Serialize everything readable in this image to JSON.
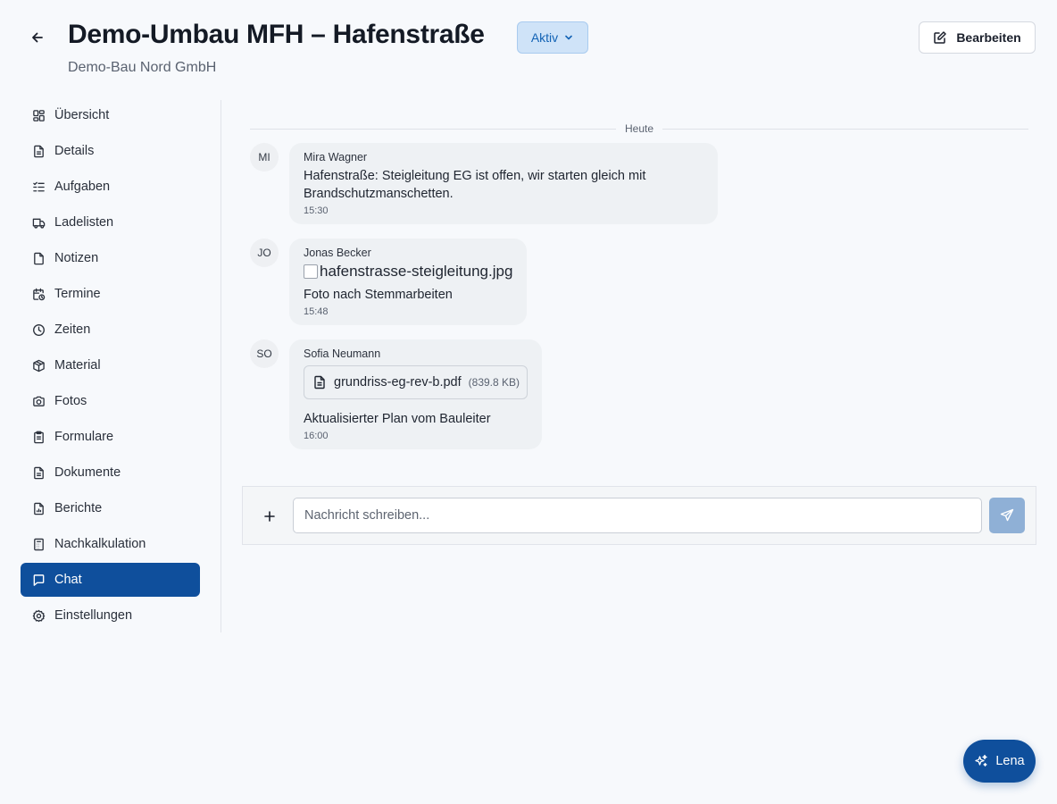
{
  "header": {
    "title": "Demo-Umbau MFH – Hafenstraße",
    "status_label": "Aktiv",
    "subtitle": "Demo-Bau Nord GmbH",
    "edit_label": "Bearbeiten",
    "back_icon": "arrow-left-icon"
  },
  "sidebar": {
    "items": [
      {
        "label": "Übersicht",
        "icon": "layout-grid-icon",
        "active": false
      },
      {
        "label": "Details",
        "icon": "file-text-icon",
        "active": false
      },
      {
        "label": "Aufgaben",
        "icon": "checklist-icon",
        "active": false
      },
      {
        "label": "Ladelisten",
        "icon": "truck-icon",
        "active": false
      },
      {
        "label": "Notizen",
        "icon": "note-icon",
        "active": false
      },
      {
        "label": "Termine",
        "icon": "calendar-clock-icon",
        "active": false
      },
      {
        "label": "Zeiten",
        "icon": "clock-icon",
        "active": false
      },
      {
        "label": "Material",
        "icon": "package-icon",
        "active": false
      },
      {
        "label": "Fotos",
        "icon": "camera-icon",
        "active": false
      },
      {
        "label": "Formulare",
        "icon": "clipboard-icon",
        "active": false
      },
      {
        "label": "Dokumente",
        "icon": "document-icon",
        "active": false
      },
      {
        "label": "Berichte",
        "icon": "chart-file-icon",
        "active": false
      },
      {
        "label": "Nachkalkulation",
        "icon": "calculator-icon",
        "active": false
      },
      {
        "label": "Chat",
        "icon": "message-square-icon",
        "active": true
      },
      {
        "label": "Einstellungen",
        "icon": "gear-icon",
        "active": false
      }
    ]
  },
  "chat": {
    "day_label": "Heute",
    "messages": [
      {
        "initials": "MI",
        "sender": "Mira Wagner",
        "text": "Hafenstraße: Steigleitung EG ist offen, wir starten gleich mit Brandschutzmanschetten.",
        "time": "15:30"
      },
      {
        "initials": "JO",
        "sender": "Jonas Becker",
        "image_alt": "hafenstrasse-steigleitung.jpg",
        "text": "Foto nach Stemmarbeiten",
        "time": "15:48"
      },
      {
        "initials": "SO",
        "sender": "Sofia Neumann",
        "file_name": "grundriss-eg-rev-b.pdf",
        "file_size": "(839.8 KB)",
        "text": "Aktualisierter Plan vom Bauleiter",
        "time": "16:00"
      }
    ]
  },
  "composer": {
    "placeholder": "Nachricht schreiben...",
    "attach_icon": "plus-icon",
    "send_icon": "send-icon"
  },
  "assistant": {
    "label": "Lena",
    "icon": "sparkles-icon"
  },
  "colors": {
    "primary": "#0f4f9c",
    "status_bg": "#cfe3f8",
    "status_text": "#1363b5",
    "bubble_bg": "#eef1f4",
    "page_bg": "#f7f9fc"
  }
}
